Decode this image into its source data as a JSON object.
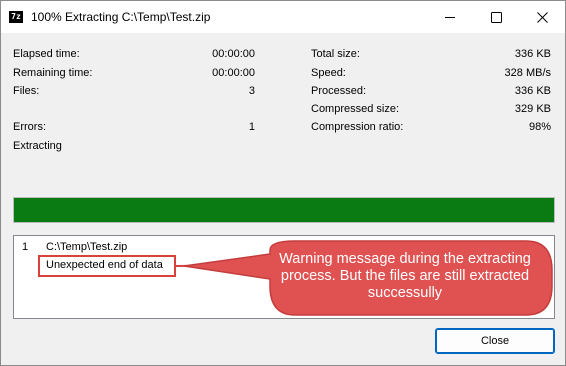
{
  "window": {
    "title": "100% Extracting C:\\Temp\\Test.zip",
    "icon_text": "7z",
    "controls": [
      "minimize-icon",
      "maximize-icon",
      "close-icon"
    ]
  },
  "stats_left": [
    {
      "label": "Elapsed time:",
      "value": "00:00:00"
    },
    {
      "label": "Remaining time:",
      "value": "00:00:00"
    },
    {
      "label": "Files:",
      "value": "3"
    },
    {
      "label": "Errors:",
      "value": "1"
    }
  ],
  "stats_right": [
    {
      "label": "Total size:",
      "value": "336 KB"
    },
    {
      "label": "Speed:",
      "value": "328 MB/s"
    },
    {
      "label": "Processed:",
      "value": "336 KB"
    },
    {
      "label": "Compressed size:",
      "value": "329 KB"
    },
    {
      "label": "Compression ratio:",
      "value": "98%"
    }
  ],
  "status": "Extracting",
  "progress": {
    "percent": 100,
    "color": "#0a7a12"
  },
  "messages": {
    "index": "1",
    "file": "C:\\Temp\\Test.zip",
    "error": "Unexpected end of data"
  },
  "callout": {
    "text": "Warning message during the extracting process. But the files are still extracted successully",
    "fill": "#e05252",
    "stroke": "#c43d3d"
  },
  "buttons": {
    "close": "Close"
  }
}
